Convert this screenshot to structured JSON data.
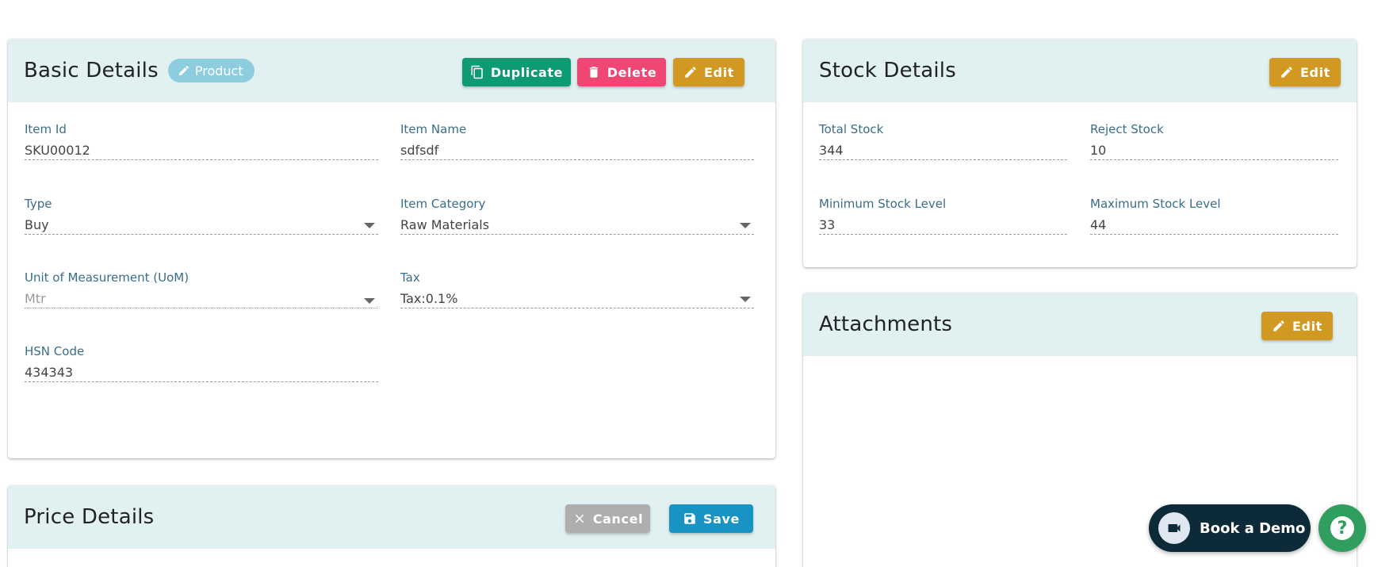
{
  "basic_details": {
    "title": "Basic Details",
    "chip_label": "Product",
    "duplicate_label": "Duplicate",
    "delete_label": "Delete",
    "edit_label": "Edit",
    "fields": {
      "item_id": {
        "label": "Item Id",
        "value": "SKU00012"
      },
      "item_name": {
        "label": "Item Name",
        "value": "sdfsdf"
      },
      "type": {
        "label": "Type",
        "value": "Buy"
      },
      "item_category": {
        "label": "Item Category",
        "value": "Raw Materials"
      },
      "uom": {
        "label": "Unit of Measurement (UoM)",
        "value": "Mtr"
      },
      "tax": {
        "label": "Tax",
        "value": "Tax:0.1%"
      },
      "hsn": {
        "label": "HSN Code",
        "value": "434343"
      }
    }
  },
  "stock_details": {
    "title": "Stock Details",
    "edit_label": "Edit",
    "fields": {
      "total_stock": {
        "label": "Total Stock",
        "value": "344"
      },
      "reject_stock": {
        "label": "Reject Stock",
        "value": "10"
      },
      "min_stock": {
        "label": "Minimum Stock Level",
        "value": "33"
      },
      "max_stock": {
        "label": "Maximum Stock Level",
        "value": "44"
      }
    }
  },
  "attachments": {
    "title": "Attachments",
    "edit_label": "Edit"
  },
  "price_details": {
    "title": "Price Details",
    "cancel_label": "Cancel",
    "save_label": "Save"
  },
  "widgets": {
    "book_demo_label": "Book a Demo",
    "help_glyph": "?"
  },
  "colors": {
    "header_bg": "#e1f1f2",
    "duplicate": "#0e9a74",
    "delete": "#ef4673",
    "edit": "#d19922",
    "cancel": "#aeaeae",
    "save": "#1993c2",
    "label": "#3a6d8a"
  },
  "icons": {
    "duplicate": "copy-icon",
    "delete": "trash-icon",
    "edit": "pencil-icon",
    "cancel": "close-icon",
    "save": "floppy-icon",
    "demo": "video-camera-icon",
    "help": "question-icon"
  }
}
